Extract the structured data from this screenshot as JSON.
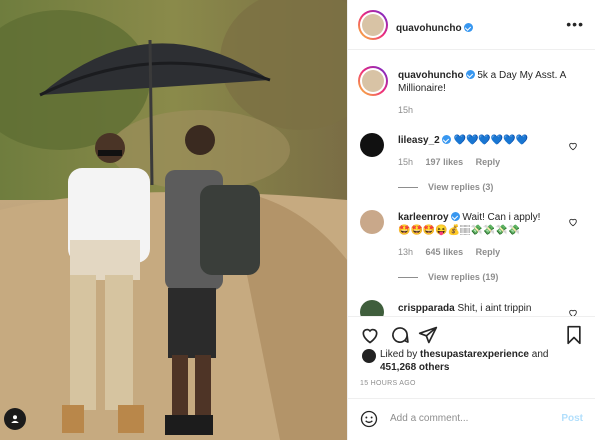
{
  "header": {
    "username": "quavohuncho"
  },
  "caption": {
    "username": "quavohuncho",
    "text": "5k a Day My Asst. A Millionaire!",
    "time": "15h"
  },
  "comments": [
    {
      "username": "lileasy_2",
      "text": "💙💙💙💙💙💙",
      "time": "15h",
      "likes": "197 likes",
      "reply": "Reply",
      "view_replies": "View replies (3)"
    },
    {
      "username": "karleenroy",
      "text": "Wait! Can i apply!",
      "text2": "🤩🤩🤩😝💰🏽💸💸💸💸",
      "time": "13h",
      "likes": "645 likes",
      "reply": "Reply",
      "view_replies": "View replies (19)"
    },
    {
      "username": "crispparada",
      "text": "Shit, i aint trippin"
    }
  ],
  "liked_by": {
    "prefix": "Liked by",
    "user": "thesupastarexperience",
    "and": "and",
    "others": "451,268 others"
  },
  "time_ago": "15 HOURS AGO",
  "add_comment": {
    "placeholder": "Add a comment...",
    "post": "Post"
  },
  "icons": {
    "more": "more-icon",
    "like": "heart-icon",
    "comment": "comment-icon",
    "share": "send-icon",
    "save": "bookmark-icon",
    "emoji": "emoji-icon",
    "tag": "user-tag-icon"
  }
}
